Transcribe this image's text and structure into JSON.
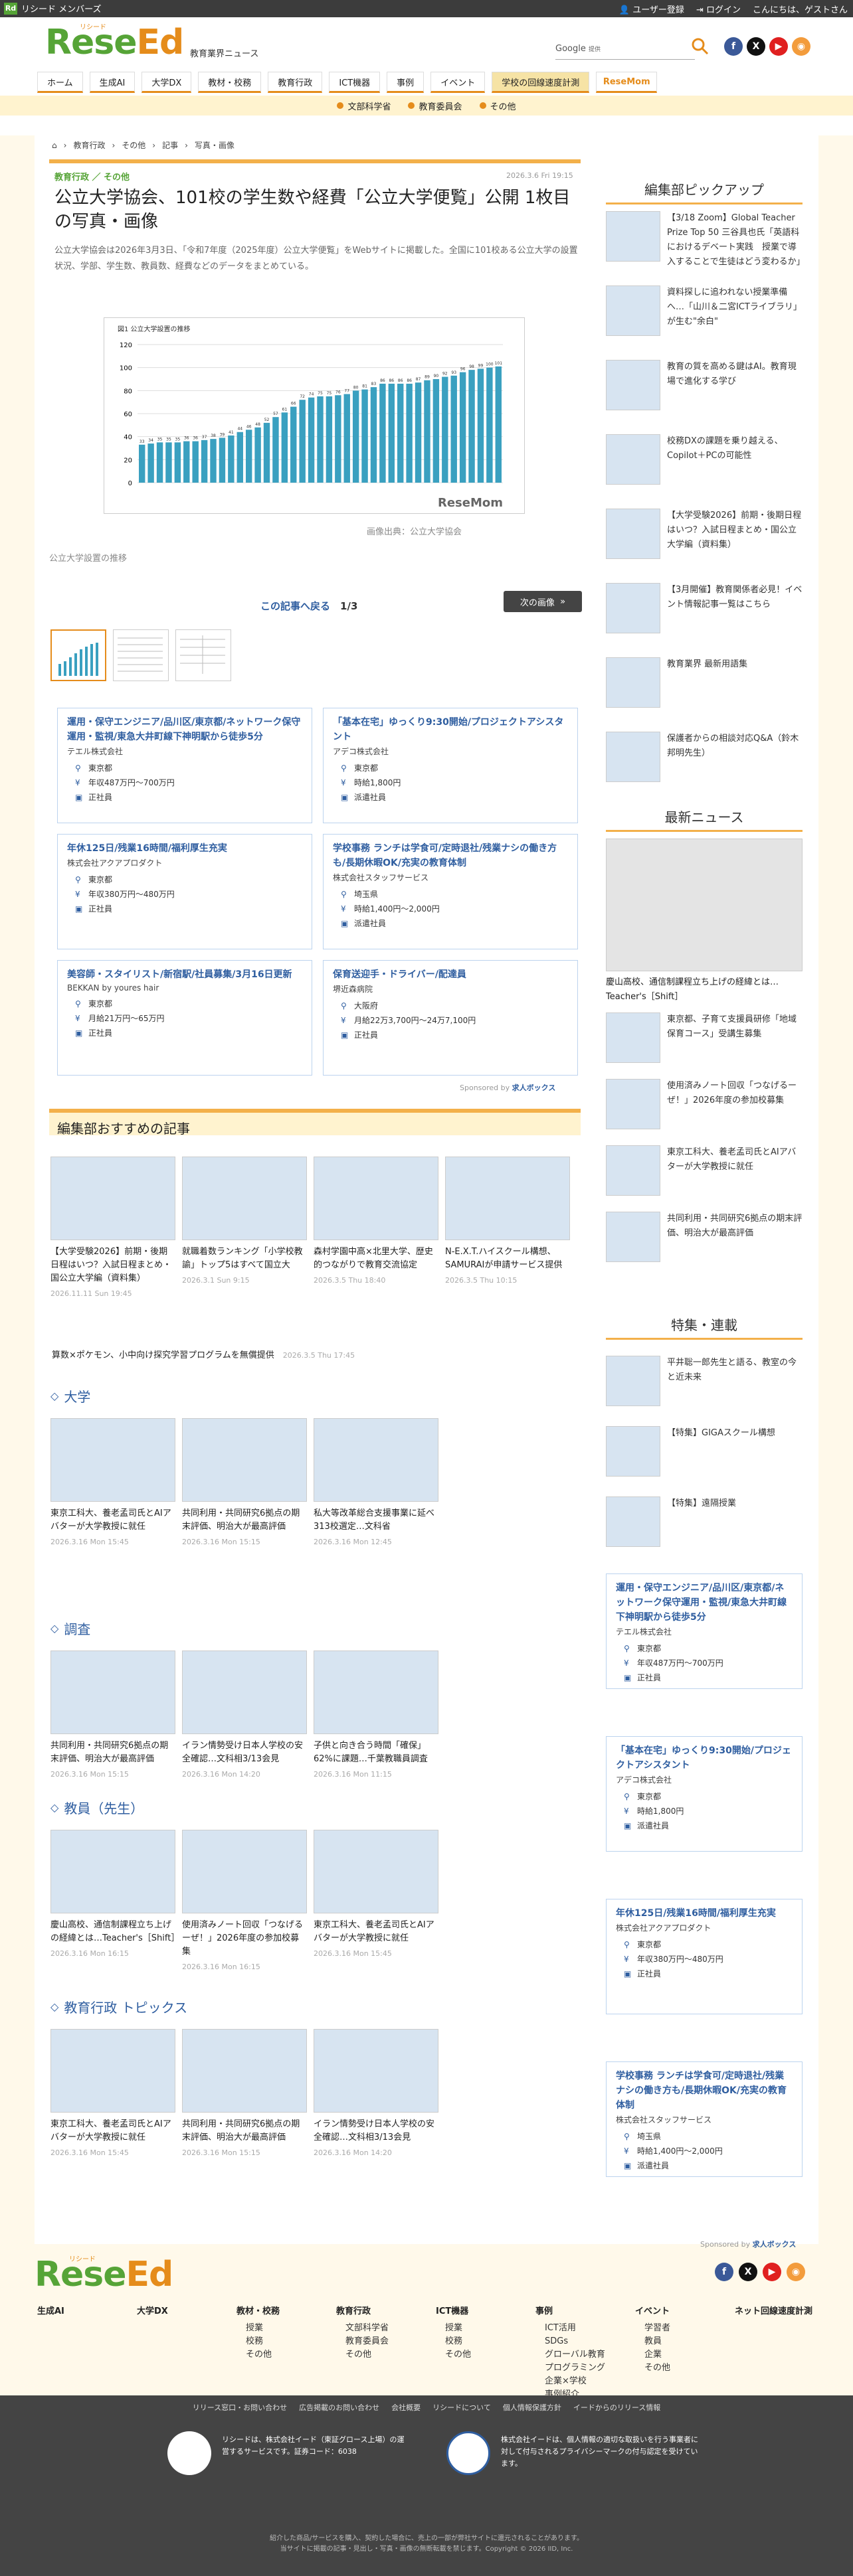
{
  "topbar": {
    "members": "リシード メンバーズ",
    "register": "ユーザー登録",
    "login": "ログイン",
    "greeting": "こんにちは、ゲストさん"
  },
  "header": {
    "logo_text": "ReseEd",
    "logo_kana": "リシード",
    "tagline": "教育業界ニュース",
    "search_label": "Google",
    "search_placeholder": "提供",
    "nav": [
      "ホーム",
      "生成AI",
      "大学DX",
      "教材・校務",
      "教育行政",
      "ICT機器",
      "事例",
      "イベント",
      "学校の回線速度計測",
      "ReseMom"
    ],
    "subnav": [
      "文部科学省",
      "教育委員会",
      "その他"
    ]
  },
  "breadcrumb": [
    "教育行政",
    "その他",
    "記事",
    "写真・画像"
  ],
  "article": {
    "category": "教育行政 ／ その他",
    "date": "2026.3.6 Fri 19:15",
    "title": "公立大学協会、101校の学生数や経費「公立大学便覧」公開 1枚目の写真・画像",
    "lead": "公立大学協会は2026年3月3日、「令和7年度（2025年度）公立大学便覧」をWebサイトに掲載した。全国に101校ある公立大学の設置状況、学部、学生数、教員数、経費などのデータをまとめている。",
    "caption": "画像出典：公立大学協会",
    "image_alt": "公立大学設置の推移",
    "back_link": "この記事へ戻る",
    "pager": "1/3",
    "next": "次の画像",
    "watermark": "ReseMom"
  },
  "chart_data": {
    "type": "bar",
    "title": "公立大学設置の推移",
    "title_prefix": "図1",
    "ylim": [
      0,
      120
    ],
    "yticks": [
      0,
      20,
      40,
      60,
      80,
      100,
      120
    ],
    "values": [
      33,
      34,
      35,
      35,
      35,
      36,
      36,
      37,
      38,
      39,
      41,
      44,
      46,
      48,
      52,
      57,
      61,
      66,
      72,
      74,
      75,
      75,
      76,
      77,
      80,
      81,
      83,
      86,
      86,
      86,
      86,
      87,
      89,
      90,
      92,
      93,
      96,
      98,
      99,
      100,
      101
    ]
  },
  "jobs": [
    {
      "title": "運用・保守エンジニア/品川区/東京都/ネットワーク保守運用・監視/東急大井町線下神明駅から徒歩5分",
      "company": "テエル株式会社",
      "loc": "東京都",
      "pay": "年収487万円〜700万円",
      "type": "正社員"
    },
    {
      "title": "「基本在宅」ゆっくり9:30開始/プロジェクトアシスタント",
      "company": "アデコ株式会社",
      "loc": "東京都",
      "pay": "時給1,800円",
      "type": "派遣社員"
    },
    {
      "title": "年休125日/残業16時間/福利厚生充実",
      "company": "株式会社アクアプロダクト",
      "loc": "東京都",
      "pay": "年収380万円〜480万円",
      "type": "正社員"
    },
    {
      "title": "学校事務 ランチは学食可/定時退社/残業ナシの働き方も/長期休暇OK/充実の教育体制",
      "company": "株式会社スタッフサービス",
      "loc": "埼玉県",
      "pay": "時給1,400円〜2,000円",
      "type": "派遣社員"
    },
    {
      "title": "美容師・スタイリスト/新宿駅/社員募集/3月16日更新",
      "company": "BEKKAN by youres hair",
      "loc": "東京都",
      "pay": "月給21万円〜65万円",
      "type": "正社員"
    },
    {
      "title": "保育送迎手・ドライバー/配達員",
      "company": "堺近森病院",
      "loc": "大阪府",
      "pay": "月給22万3,700円〜24万7,100円",
      "type": "正社員"
    }
  ],
  "sponsor": {
    "text": "Sponsored by",
    "brand": "求人ボックス"
  },
  "recommend": {
    "heading": "編集部おすすめの記事",
    "items": [
      {
        "title": "【大学受験2026】前期・後期日程はいつ？入試日程まとめ・国公立大学編（資料集）",
        "date": "2026.11.11 Sun 19:45"
      },
      {
        "title": "就職着数ランキング「小学校教諭」トップ5はすべて国立大",
        "date": "2026.3.1 Sun 9:15"
      },
      {
        "title": "森村学園中高×北里大学、歴史的つながりで教育交流協定",
        "date": "2026.3.5 Thu 18:40"
      },
      {
        "title": "N-E.X.T.ハイスクール構想、SAMURAIが申請サービス提供",
        "date": "2026.3.5 Thu 10:15"
      }
    ],
    "text_link": "算数×ポケモン、小中向け探究学習プログラムを無償提供",
    "text_link_date": "2026.3.5 Thu 17:45"
  },
  "tag_sections": [
    {
      "name": "大学",
      "items": [
        {
          "title": "東京工科大、養老孟司氏とAIアバターが大学教授に就任",
          "date": "2026.3.16 Mon 15:45"
        },
        {
          "title": "共同利用・共同研究6拠点の期末評価、明治大が最高評価",
          "date": "2026.3.16 Mon 15:15"
        },
        {
          "title": "私大等改革総合支援事業に延べ313校選定…文科省",
          "date": "2026.3.16 Mon 12:45"
        }
      ]
    },
    {
      "name": "調査",
      "items": [
        {
          "title": "共同利用・共同研究6拠点の期末評価、明治大が最高評価",
          "date": "2026.3.16 Mon 15:15"
        },
        {
          "title": "イラン情勢受け日本人学校の安全確認…文科相3/13会見",
          "date": "2026.3.16 Mon 14:20"
        },
        {
          "title": "子供と向き合う時間「確保」62%に課題…千葉教職員調査",
          "date": "2026.3.16 Mon 11:15"
        }
      ]
    },
    {
      "name": "教員（先生）",
      "items": [
        {
          "title": "慶山高校、通信制課程立ち上げの経緯とは…Teacher's［Shift］",
          "date": "2026.3.16 Mon 16:15"
        },
        {
          "title": "使用済みノート回収「つなげるーぜ！」2026年度の参加校募集",
          "date": "2026.3.16 Mon 16:15"
        },
        {
          "title": "東京工科大、養老孟司氏とAIアバターが大学教授に就任",
          "date": "2026.3.16 Mon 15:45"
        }
      ]
    },
    {
      "name": "教育行政 トピックス",
      "items": [
        {
          "title": "東京工科大、養老孟司氏とAIアバターが大学教授に就任",
          "date": "2026.3.16 Mon 15:45"
        },
        {
          "title": "共同利用・共同研究6拠点の期末評価、明治大が最高評価",
          "date": "2026.3.16 Mon 15:15"
        },
        {
          "title": "イラン情勢受け日本人学校の安全確認…文科相3/13会見",
          "date": "2026.3.16 Mon 14:20"
        }
      ]
    }
  ],
  "sidebar": {
    "pickup_heading": "編集部ピックアップ",
    "pickup": [
      "【3/18 Zoom】Global Teacher Prize Top 50 三谷具也氏「英語科におけるデベート実践　授業で導入することで生徒はどう変わるか」",
      "資料探しに追われない授業準備へ…「山川＆二宮ICTライブラリ」が生む\"余白\"",
      "教育の質を高める鍵はAI。教育現場で進化する学び",
      "校務DXの課題を乗り越える、Copilot＋PCの可能性",
      "【大学受験2026】前期・後期日程はいつ？入試日程まとめ・国公立大学編（資料集）",
      "【3月開催】教育関係者必見！イベント情報記事一覧はこちら",
      "教育業界 最新用語集",
      "保護者からの相談対応Q&A（鈴木邦明先生）"
    ],
    "latest_heading": "最新ニュース",
    "latest_main": "慶山高校、通信制課程立ち上げの経緯とは…Teacher's［Shift］",
    "latest": [
      "東京都、子育て支援員研修「地域保育コース」受講生募集",
      "使用済みノート回収「つなげるーぜ！」2026年度の参加校募集",
      "東京工科大、養老孟司氏とAIアバターが大学教授に就任",
      "共同利用・共同研究6拠点の期末評価、明治大が最高評価"
    ],
    "feature_heading": "特集・連載",
    "features": [
      "平井聡一郎先生と語る、教室の今と近未来",
      "【特集】GIGAスクール構想",
      "【特集】遠隔授業"
    ],
    "jobs": [
      0,
      1,
      2,
      3
    ]
  },
  "footer": {
    "cols": [
      {
        "h": "生成AI",
        "items": []
      },
      {
        "h": "大学DX",
        "items": []
      },
      {
        "h": "教材・校務",
        "items": [
          "授業",
          "校務",
          "その他"
        ]
      },
      {
        "h": "教育行政",
        "items": [
          "文部科学省",
          "教育委員会",
          "その他"
        ]
      },
      {
        "h": "ICT機器",
        "items": [
          "授業",
          "校務",
          "その他"
        ]
      },
      {
        "h": "事例",
        "items": [
          "ICT活用",
          "SDGs",
          "グローバル教育",
          "プログラミング",
          "企業×学校",
          "事例紹介",
          "その他"
        ]
      },
      {
        "h": "イベント",
        "items": [
          "学習者",
          "教員",
          "企業",
          "その他"
        ]
      },
      {
        "h": "ネット回線速度計測",
        "items": []
      }
    ],
    "links": [
      "リリース窓口・お問い合わせ",
      "広告掲載のお問い合わせ",
      "会社概要",
      "リシードについて",
      "個人情報保護方針",
      "イードからのリリース情報"
    ],
    "privacy1": "リシードは、株式会社イード（東証グロース上場）の運営するサービスです。証券コード：6038",
    "privacy2": "株式会社イードは、個人情報の適切な取扱いを行う事業者に対して付与されるプライバシーマークの付与認定を受けています。",
    "copy1": "紹介した商品/サービスを購入、契約した場合に、売上の一部が弊社サイトに還元されることがあります。",
    "copy2": "当サイトに掲載の記事・見出し・写真・画像の無断転載を禁じます。Copyright © 2026 IID, Inc."
  },
  "colors": {
    "green": "#56a437",
    "orange": "#e58c1b",
    "blue": "#2f5ea0"
  }
}
